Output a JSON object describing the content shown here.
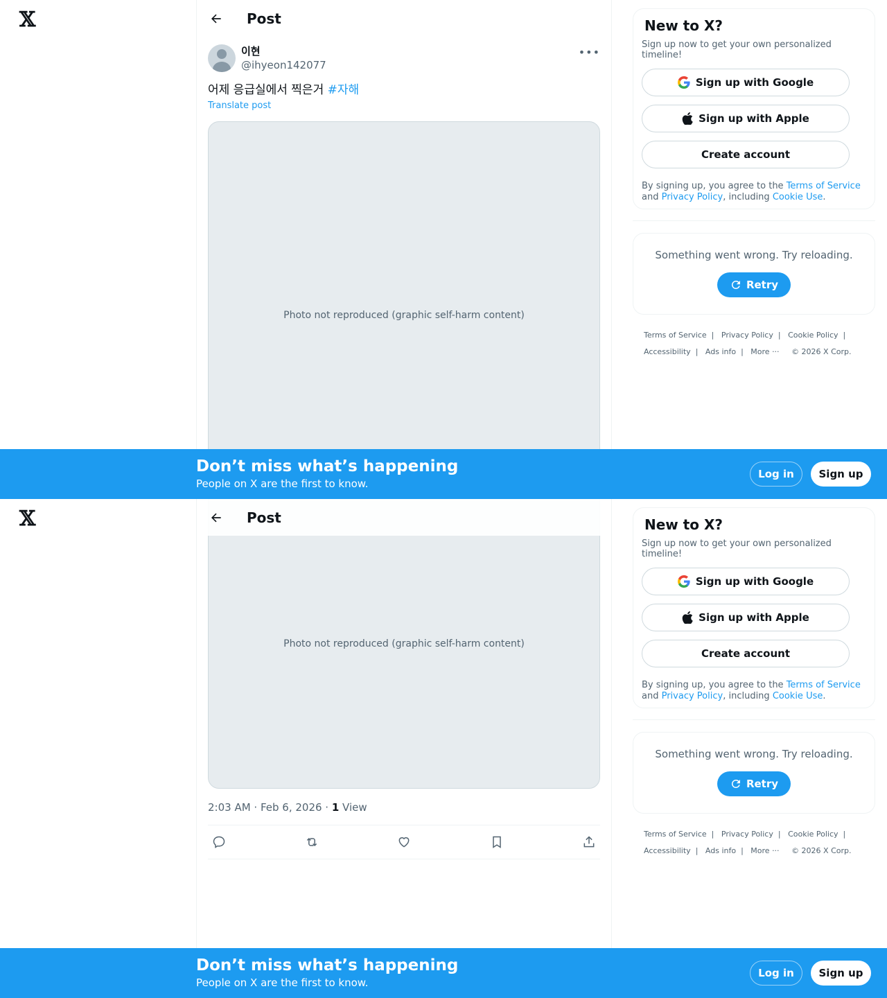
{
  "brand": {
    "logo": "𝕏",
    "accent": "#1d9bf0"
  },
  "header": {
    "title": "Post"
  },
  "post": {
    "display_name": "이현",
    "handle": "@ihyeon142077",
    "text": "어제 응급실에서 찍은거",
    "hashtag": "#자해",
    "translate": "Translate post",
    "timestamp": "2:03 AM · Feb 6, 2026 · ",
    "views_count": "1",
    "views_label": " View",
    "media_placeholder": "Photo not reproduced (graphic self-harm content)"
  },
  "signup": {
    "title": "New to X?",
    "subtitle": "Sign up now to get your own personalized timeline!",
    "google": "Sign up with Google",
    "apple": "Sign up with Apple",
    "create": "Create account",
    "legal_1": "By signing up, you agree to the ",
    "tos": "Terms of Service",
    "legal_2": " and ",
    "privacy": "Privacy Policy",
    "legal_3": ", including ",
    "cookie": "Cookie Use",
    "legal_4": "."
  },
  "error": {
    "text": "Something went wrong. Try reloading.",
    "retry": "Retry"
  },
  "footer": {
    "tos": "Terms of Service",
    "privacy": "Privacy Policy",
    "cookie": "Cookie Policy",
    "accessibility": "Accessibility",
    "ads": "Ads info",
    "more": "More ···",
    "copyright": "© 2026 X Corp."
  },
  "banner": {
    "title": "Don’t miss what’s happening",
    "subtitle": "People on X are the first to know.",
    "login": "Log in",
    "signup": "Sign up"
  }
}
